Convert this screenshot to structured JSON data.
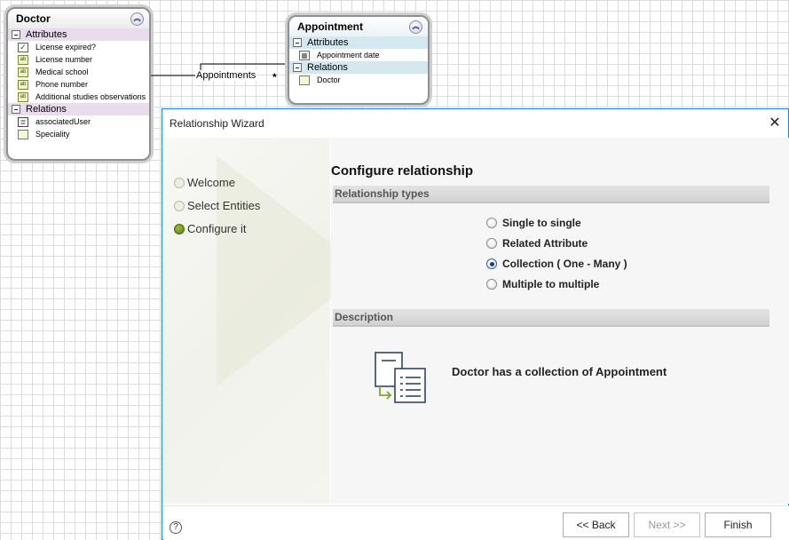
{
  "doctor": {
    "title": "Doctor",
    "attributes_label": "Attributes",
    "attributes": [
      {
        "label": "License expired?",
        "icon": "checkbox-icon"
      },
      {
        "label": "License number",
        "icon": "text-field-icon"
      },
      {
        "label": "Medical school",
        "icon": "text-field-icon"
      },
      {
        "label": "Phone number",
        "icon": "text-field-icon"
      },
      {
        "label": "Additional studies observations",
        "icon": "text-field-icon"
      }
    ],
    "relations_label": "Relations",
    "relations": [
      {
        "label": "associatedUser",
        "icon": "user-relation-icon"
      },
      {
        "label": "Speciality",
        "icon": "table-relation-icon"
      }
    ]
  },
  "appointment": {
    "title": "Appointment",
    "attributes_label": "Attributes",
    "attributes": [
      {
        "label": "Appointment date",
        "icon": "date-field-icon"
      }
    ],
    "relations_label": "Relations",
    "relations": [
      {
        "label": "Doctor",
        "icon": "relation-icon"
      }
    ]
  },
  "connector": {
    "label": "Appointments",
    "cardinality": "*"
  },
  "dialog": {
    "title": "Relationship Wizard",
    "steps": [
      {
        "label": "Welcome",
        "active": false
      },
      {
        "label": "Select Entities",
        "active": false
      },
      {
        "label": "Configure it",
        "active": true
      }
    ],
    "content_title": "Configure relationship",
    "types_header": "Relationship types",
    "types": [
      {
        "label": "Single to single",
        "checked": false
      },
      {
        "label": "Related Attribute",
        "checked": false
      },
      {
        "label": "Collection ( One - Many )",
        "checked": true
      },
      {
        "label": "Multiple to multiple",
        "checked": false
      }
    ],
    "description_header": "Description",
    "description_text": "Doctor has a collection of Appointment",
    "help_label": "?",
    "buttons": {
      "back": "<< Back",
      "next": "Next >>",
      "finish": "Finish"
    },
    "close_label": "✕"
  },
  "colors": {
    "dialog_border": "#1883d7",
    "active_step": "#6a8c18",
    "doctor_section": "#e8dced",
    "appointment_section": "#d4e8f2"
  }
}
